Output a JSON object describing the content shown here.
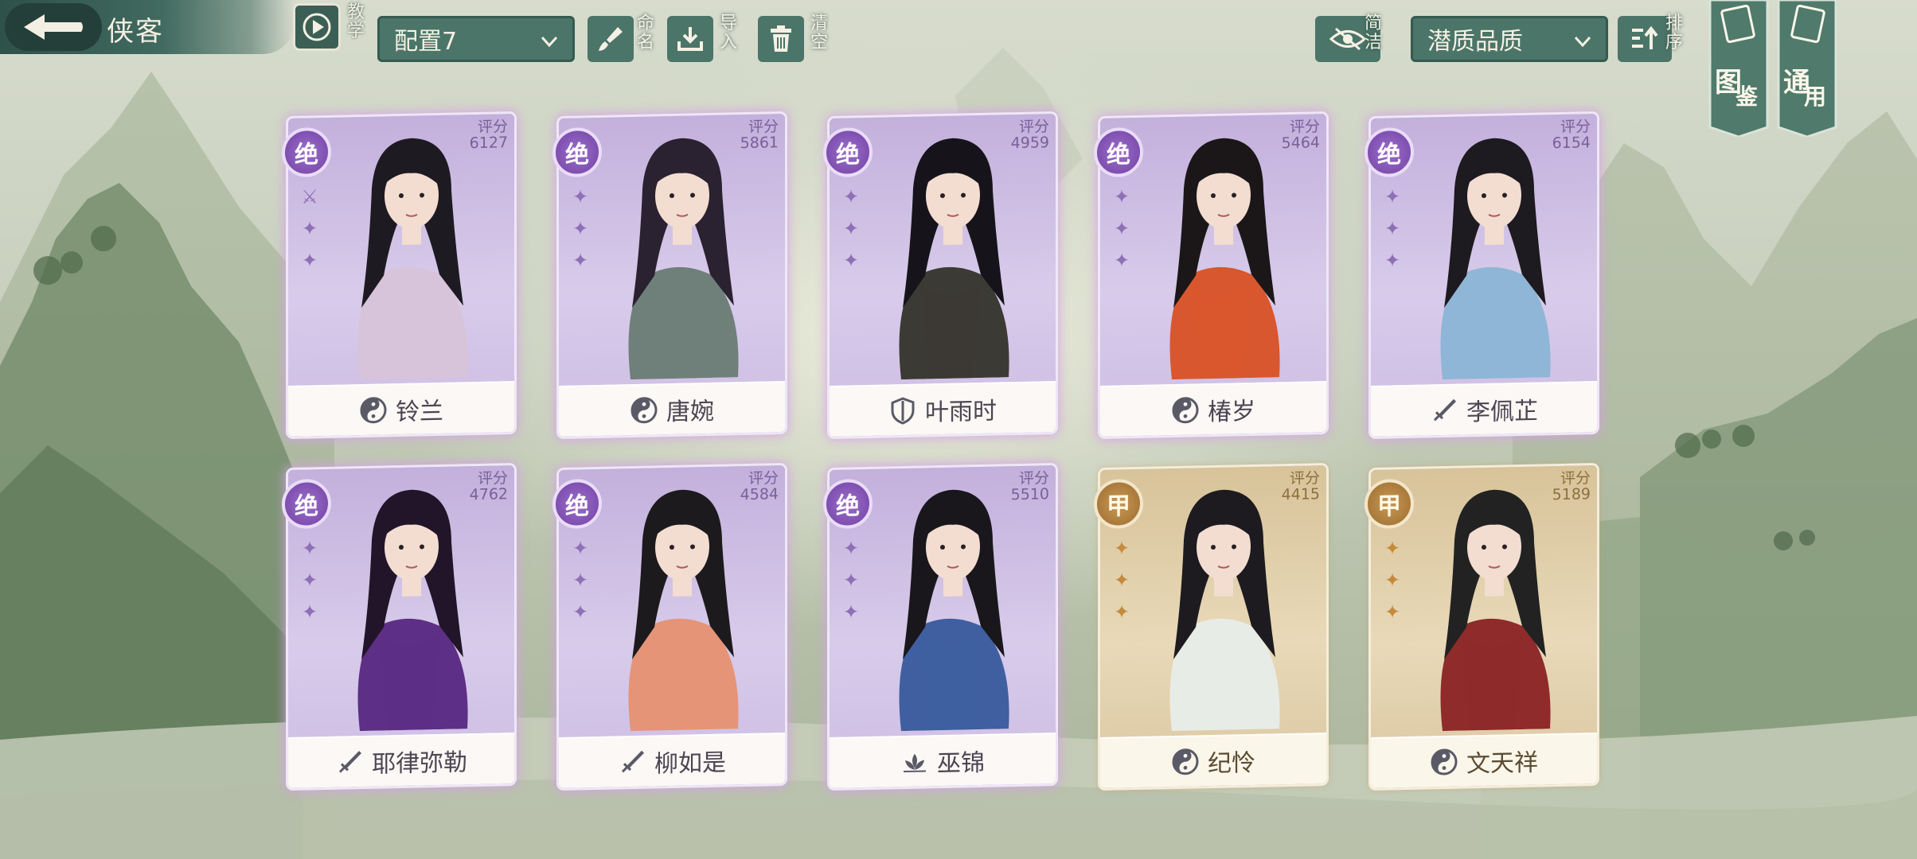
{
  "header": {
    "title": "侠客",
    "tutorial_label": "教学",
    "config_select": "配置7",
    "rename_label": "命名",
    "import_label": "导入",
    "clear_label": "清空",
    "simple_label": "简洁",
    "sort_select": "潜质品质",
    "sort_label": "排序",
    "gallery_label": "图鉴",
    "common_label": "通用"
  },
  "score_label": "评分",
  "colors": {
    "teal_dark": "#2e5149",
    "teal": "#4b7568",
    "purple_card": "#c3b0dc",
    "gold_card": "#d8c39a"
  },
  "cards": [
    {
      "name": "铃兰",
      "score": "6127",
      "rank": "绝",
      "tier": "purple",
      "class_icon": "yin-yang-icon",
      "ribbon": [
        "⚔",
        "✦",
        "✦"
      ]
    },
    {
      "name": "唐婉",
      "score": "5861",
      "rank": "绝",
      "tier": "purple",
      "class_icon": "yin-yang-icon",
      "ribbon": [
        "✦",
        "✦",
        "✦"
      ]
    },
    {
      "name": "叶雨时",
      "score": "4959",
      "rank": "绝",
      "tier": "purple",
      "class_icon": "shield-icon",
      "ribbon": [
        "✦",
        "✦",
        "✦"
      ]
    },
    {
      "name": "椿岁",
      "score": "5464",
      "rank": "绝",
      "tier": "purple",
      "class_icon": "yin-yang-icon",
      "ribbon": [
        "✦",
        "✦",
        "✦"
      ]
    },
    {
      "name": "李佩芷",
      "score": "6154",
      "rank": "绝",
      "tier": "purple",
      "class_icon": "sword-icon",
      "ribbon": [
        "✦",
        "✦",
        "✦"
      ]
    },
    {
      "name": "耶律弥勒",
      "score": "4762",
      "rank": "绝",
      "tier": "purple",
      "class_icon": "sword-icon",
      "ribbon": [
        "✦",
        "✦",
        "✦"
      ]
    },
    {
      "name": "柳如是",
      "score": "4584",
      "rank": "绝",
      "tier": "purple",
      "class_icon": "sword-icon",
      "ribbon": [
        "✦",
        "✦",
        "✦"
      ]
    },
    {
      "name": "巫锦",
      "score": "5510",
      "rank": "绝",
      "tier": "purple",
      "class_icon": "lotus-icon",
      "ribbon": [
        "✦",
        "✦",
        "✦"
      ]
    },
    {
      "name": "纪怜",
      "score": "4415",
      "rank": "甲",
      "tier": "gold",
      "class_icon": "yin-yang-icon",
      "ribbon": [
        "✦",
        "✦",
        "✦"
      ]
    },
    {
      "name": "文天祥",
      "score": "5189",
      "rank": "甲",
      "tier": "gold",
      "class_icon": "yin-yang-icon",
      "ribbon": [
        "✦",
        "✦",
        "✦"
      ]
    }
  ]
}
